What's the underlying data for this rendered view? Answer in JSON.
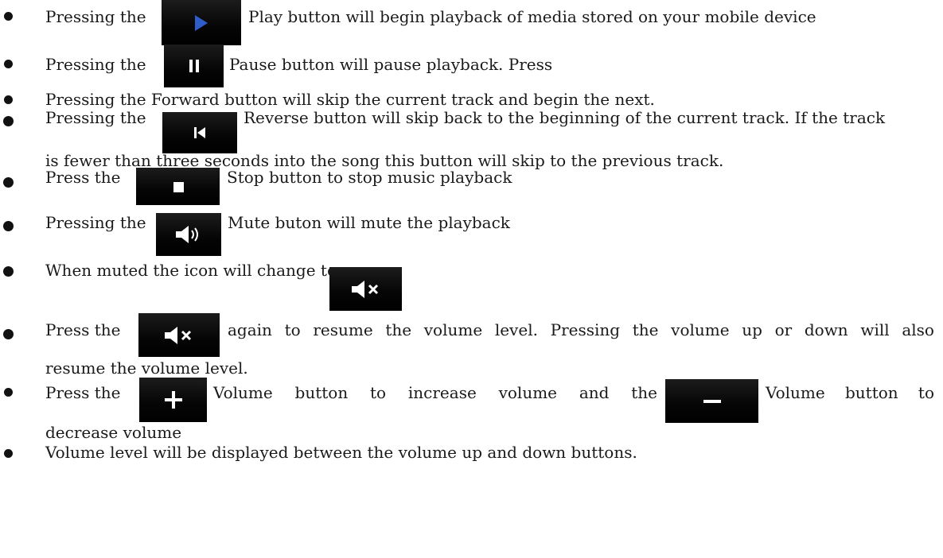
{
  "items": {
    "play": {
      "pre": "Pressing the",
      "post": "Play button will begin playback of media stored on your mobile device"
    },
    "pause": {
      "pre": "Pressing the",
      "post": "Pause button will pause playback. Press"
    },
    "forward": {
      "text": "Pressing the  Forward button will skip the current track and begin the next."
    },
    "reverse": {
      "pre": "Pressing the",
      "post": "Reverse button  will skip back to the beginning of the current track. If the track",
      "cont": "is fewer than three seconds into the song this button will skip to the previous track."
    },
    "stop": {
      "pre": "Press the",
      "post": "Stop button to stop music playback"
    },
    "mute": {
      "pre": "Pressing the",
      "post": "Mute buton will mute the playback"
    },
    "muted": {
      "text": "When muted the icon will change to"
    },
    "resume": {
      "pre": "Press the",
      "post_words": [
        "again",
        "to",
        "resume",
        "the",
        "volume",
        "level.",
        "Pressing",
        "the",
        "volume",
        "up",
        "or",
        "down",
        "will",
        "also"
      ],
      "cont": "resume the volume level."
    },
    "volume": {
      "pre": "Press the",
      "mid_words": [
        "Volume",
        "button",
        "to",
        "increase",
        "volume",
        "and",
        "the"
      ],
      "post_words": [
        "Volume",
        "button",
        "to"
      ],
      "cont": "decrease volume"
    },
    "level": {
      "text": "Volume level will be displayed between the volume up and down buttons."
    }
  },
  "icons": {
    "play": "play-icon",
    "pause": "pause-icon",
    "reverse": "skip-back-icon",
    "stop": "stop-icon",
    "speaker": "speaker-icon",
    "muted": "speaker-muted-icon",
    "plus": "volume-plus-icon",
    "minus": "volume-minus-icon"
  },
  "colors": {
    "button_bg": "#000000",
    "play_blue": "#2f5cc9",
    "icon_white": "#ffffff"
  }
}
